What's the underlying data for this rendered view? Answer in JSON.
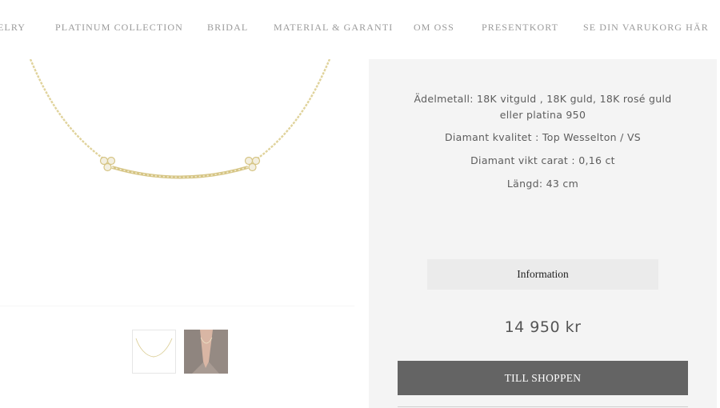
{
  "nav": {
    "items": [
      "ELRY",
      "PLATINUM COLLECTION",
      "BRIDAL",
      "MATERIAL & GARANTI",
      "OM OSS",
      "PRESENTKORT",
      "SE DIN VARUKORG HÄR"
    ]
  },
  "product": {
    "specs": [
      "Ädelmetall: 18K vitguld , 18K guld, 18K rosé guld eller platina 950",
      "Diamant kvalitet : Top Wesselton / VS",
      "Diamant vikt carat : 0,16 ct",
      "Längd: 43 cm"
    ],
    "info_label": "Information",
    "price": "14 950 kr",
    "shop_label": "TILL SHOPPEN"
  },
  "colors": {
    "gold": "#d8c98a",
    "panel_bg": "#f4f4f4",
    "shop_button": "#646464"
  }
}
